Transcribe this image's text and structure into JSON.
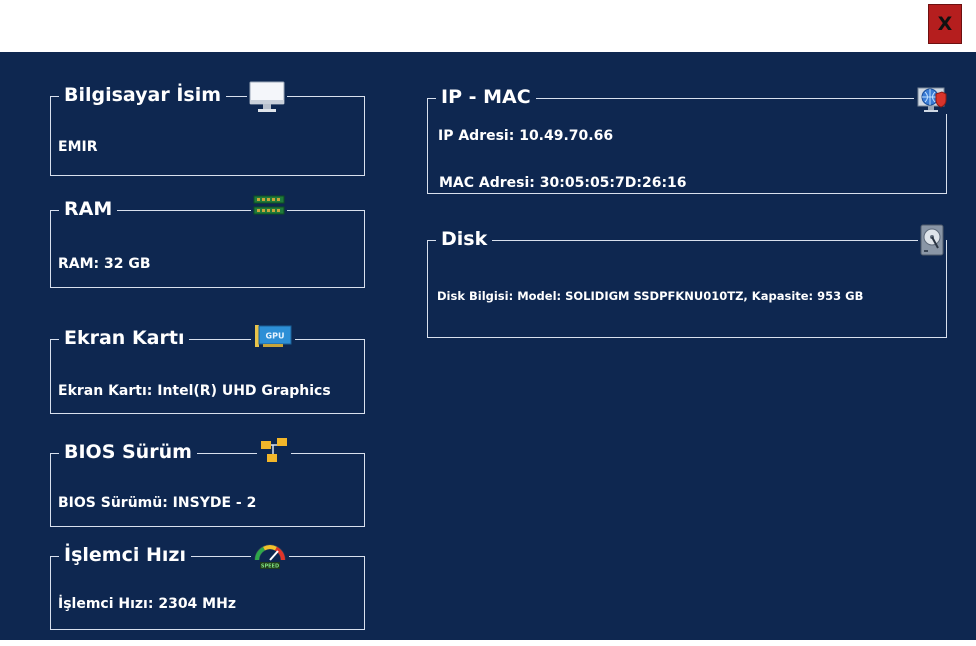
{
  "window": {
    "close_label": "X"
  },
  "cards": {
    "computer_name": {
      "title": "Bilgisayar İsim",
      "value": "EMIR",
      "icon": "monitor-icon"
    },
    "ram": {
      "title": "RAM",
      "value": "RAM: 32 GB",
      "icon": "ram-icon"
    },
    "gpu": {
      "title": "Ekran Kartı",
      "value": "Ekran Kartı: Intel(R) UHD Graphics",
      "icon": "gpu-icon",
      "icon_text": "GPU"
    },
    "bios": {
      "title": "BIOS Sürüm",
      "value": "BIOS Sürümü: INSYDE - 2",
      "icon": "folder-tree-icon"
    },
    "cpu_speed": {
      "title": "İşlemci Hızı",
      "value": "İşlemci Hızı: 2304 MHz",
      "icon": "speedometer-icon",
      "icon_text": "SPEED"
    },
    "ip_mac": {
      "title": "IP - MAC",
      "ip": "IP Adresi: 10.49.70.66",
      "mac": "MAC Adresi: 30:05:05:7D:26:16",
      "icon": "network-globe-icon"
    },
    "disk": {
      "title": "Disk",
      "value": "Disk Bilgisi: Model: SOLIDIGM SSDPFKNU010TZ, Kapasite: 953 GB",
      "icon": "hard-disk-icon"
    }
  },
  "colors": {
    "background": "#0e2750",
    "border": "#d8e0ee",
    "close_button": "#b51e1e"
  }
}
